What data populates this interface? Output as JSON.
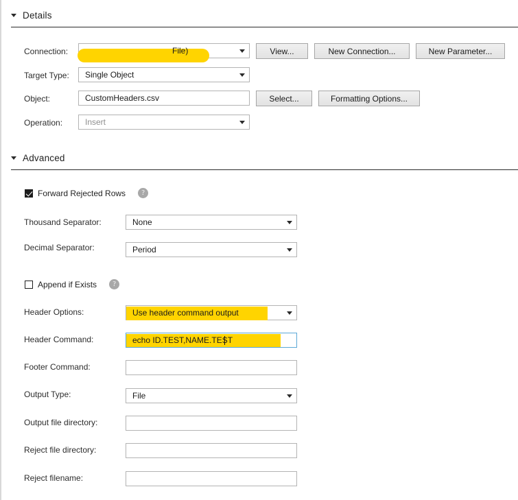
{
  "sections": {
    "details": {
      "title": "Details",
      "fields": {
        "connection": {
          "label": "Connection:",
          "value": "File)",
          "redacted": true
        },
        "target_type": {
          "label": "Target Type:",
          "value": "Single Object"
        },
        "object": {
          "label": "Object:",
          "value": "CustomHeaders.csv"
        },
        "operation": {
          "label": "Operation:",
          "value": "Insert",
          "disabled": true
        }
      },
      "buttons": {
        "view": "View...",
        "new_connection": "New Connection...",
        "new_parameter": "New Parameter...",
        "select": "Select...",
        "formatting_options": "Formatting Options..."
      }
    },
    "advanced": {
      "title": "Advanced",
      "checkboxes": {
        "forward_rejected_rows": {
          "label": "Forward Rejected Rows",
          "checked": true,
          "help": "?"
        },
        "append_if_exists": {
          "label": "Append if Exists",
          "checked": false,
          "help": "?"
        }
      },
      "fields": {
        "thousand_separator": {
          "label": "Thousand Separator:",
          "value": "None"
        },
        "decimal_separator": {
          "label": "Decimal Separator:",
          "value": "Period"
        },
        "header_options": {
          "label": "Header Options:",
          "value": "Use header command output",
          "highlighted": true
        },
        "header_command": {
          "label": "Header Command:",
          "value": "echo ID.TEST,NAME.TEST",
          "highlighted": true,
          "focused": true
        },
        "footer_command": {
          "label": "Footer Command:",
          "value": ""
        },
        "output_type": {
          "label": "Output Type:",
          "value": "File"
        },
        "output_file_directory": {
          "label": "Output file directory:",
          "value": ""
        },
        "reject_file_directory": {
          "label": "Reject file directory:",
          "value": ""
        },
        "reject_filename": {
          "label": "Reject filename:",
          "value": ""
        }
      }
    }
  },
  "colors": {
    "highlight": "#ffd400",
    "focus_border": "#5aa7d6",
    "rule": "#2a2a2a"
  }
}
